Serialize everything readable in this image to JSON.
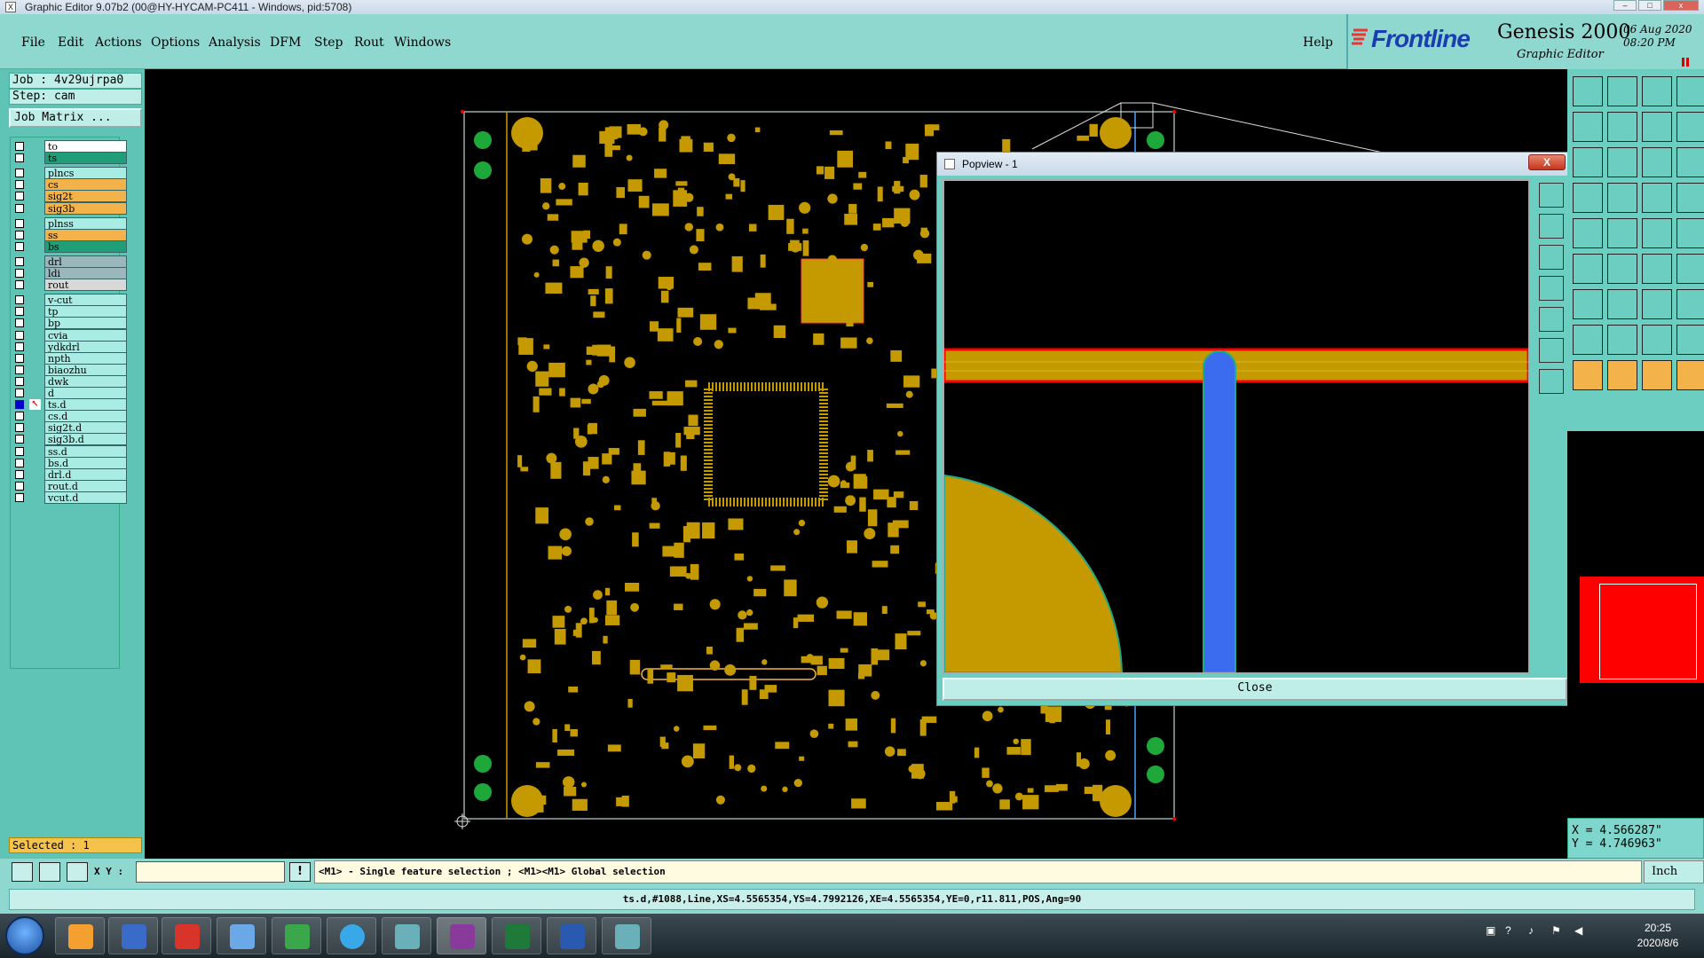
{
  "window": {
    "title": "Graphic Editor 9.07b2 (00@HY-HYCAM-PC411 - Windows, pid:5708)"
  },
  "menubar": {
    "items": [
      "File",
      "Edit",
      "Actions",
      "Options",
      "Analysis",
      "DFM",
      "Step",
      "Rout",
      "Windows"
    ],
    "help": "Help"
  },
  "brand": {
    "logo": "Frontline",
    "product": "Genesis 2000",
    "subtitle": "Graphic Editor",
    "date": "06 Aug 2020",
    "time": "08:20 PM"
  },
  "job": {
    "job_label": "Job : 4v29ujrpa0",
    "step_label": "Step: cam",
    "matrix_button": "Job Matrix ..."
  },
  "layers": [
    {
      "name": "to",
      "color": "#ffffff"
    },
    {
      "name": "ts",
      "color": "#1f9e78"
    },
    {
      "name": "plncs",
      "color": "#a8ece4"
    },
    {
      "name": "cs",
      "color": "#f4b24a"
    },
    {
      "name": "sig2t",
      "color": "#f4b24a"
    },
    {
      "name": "sig3b",
      "color": "#f4b24a"
    },
    {
      "name": "plnss",
      "color": "#a8ece4"
    },
    {
      "name": "ss",
      "color": "#f4b24a"
    },
    {
      "name": "bs",
      "color": "#1f9e78"
    },
    {
      "name": "drl",
      "color": "#9ab8bc"
    },
    {
      "name": "ldi",
      "color": "#9ab8bc"
    },
    {
      "name": "rout",
      "color": "#d8d8d8"
    },
    {
      "name": "v-cut",
      "color": "#a8ece4"
    },
    {
      "name": "tp",
      "color": "#a8ece4"
    },
    {
      "name": "bp",
      "color": "#a8ece4"
    },
    {
      "name": "cvia",
      "color": "#a8ece4"
    },
    {
      "name": "ydkdrl",
      "color": "#a8ece4"
    },
    {
      "name": "npth",
      "color": "#a8ece4"
    },
    {
      "name": "biaozhu",
      "color": "#a8ece4"
    },
    {
      "name": "dwk",
      "color": "#a8ece4"
    },
    {
      "name": "d",
      "color": "#a8ece4"
    },
    {
      "name": "ts.d",
      "color": "#a8ece4"
    },
    {
      "name": "cs.d",
      "color": "#a8ece4"
    },
    {
      "name": "sig2t.d",
      "color": "#a8ece4"
    },
    {
      "name": "sig3b.d",
      "color": "#a8ece4"
    },
    {
      "name": "ss.d",
      "color": "#a8ece4"
    },
    {
      "name": "bs.d",
      "color": "#a8ece4"
    },
    {
      "name": "drl.d",
      "color": "#a8ece4"
    },
    {
      "name": "rout.d",
      "color": "#a8ece4"
    },
    {
      "name": "vcut.d",
      "color": "#a8ece4"
    }
  ],
  "selected": "Selected : 1",
  "popview": {
    "title": "Popview - 1",
    "close_x": "X",
    "close_button": "Close"
  },
  "coords": {
    "x": "X = 4.566287\"",
    "y": "Y = 4.746963\""
  },
  "cmdbar": {
    "xy_label": "X Y :",
    "xy_value": "",
    "info_icon": "!",
    "message": "<M1> - Single feature selection ; <M1><M1> Global selection",
    "units": "Inch"
  },
  "status": "ts.d,#1088,Line,XS=4.5565354,YS=4.7992126,XE=4.5565354,YE=0,r11.811,POS,Ang=90",
  "taskbar": {
    "clock_time": "20:25",
    "clock_date": "2020/8/6"
  },
  "colors": {
    "panel": "#8fd8d0",
    "copper": "#c49a00",
    "pad_green": "#1fa83a",
    "trace_blue": "#3b6cf0"
  }
}
